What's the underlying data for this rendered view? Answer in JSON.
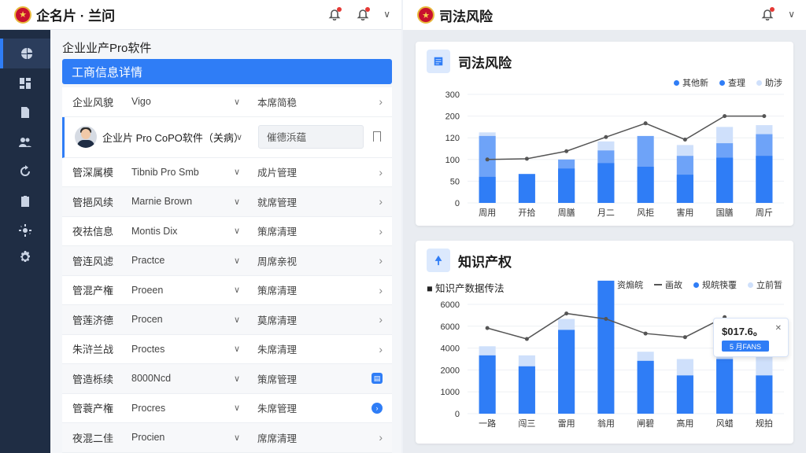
{
  "left": {
    "app_title": "企名片 · 兰问",
    "subtitle": "企业业产Pro软件",
    "section_header": "工商信息详情",
    "rows": [
      {
        "label": "企业风貌",
        "value": "Vigo",
        "status": "本席简稳",
        "end": "arrow"
      },
      {
        "label": "",
        "value": "企业片 Pro CoPO软件（关病）",
        "status": "催德浜蕴",
        "end": "bookmark",
        "selected": true
      },
      {
        "label": "管深属模",
        "value": "Tibnib Pro Smb",
        "status": "成片管理",
        "end": "arrow"
      },
      {
        "label": "管挹风续",
        "value": "Marnie Brown",
        "status": "就席管理",
        "end": "arrow"
      },
      {
        "label": "夜祛信息",
        "value": "Montis Dix",
        "status": "策席清理",
        "end": "arrow"
      },
      {
        "label": "管连风滤",
        "value": "Practce",
        "status": "周席亲视",
        "end": "arrow"
      },
      {
        "label": "管混产権",
        "value": "Proeen",
        "status": "策席清理",
        "end": "arrow"
      },
      {
        "label": "管莲济德",
        "value": "Procen",
        "status": "莫席清理",
        "end": "arrow"
      },
      {
        "label": "朱浒兰战",
        "value": "Proctes",
        "status": "朱席清理",
        "end": "arrow"
      },
      {
        "label": "管造栎续",
        "value": "8000Ncd",
        "status": "策席管理",
        "end": "square"
      },
      {
        "label": "管蓑产権",
        "value": "Procres",
        "status": "朱席管理",
        "end": "circle"
      },
      {
        "label": "夜混二佳",
        "value": "Procien",
        "status": "席席清理",
        "end": "arrow"
      }
    ]
  },
  "right": {
    "app_title": "司法风险",
    "card1": {
      "title": "司法风险",
      "legend": [
        "其他新",
        "查理",
        "助涉"
      ]
    },
    "card2": {
      "title": "知识产权",
      "legend_title": "知识产数据传法",
      "legend": [
        "资煽皖",
        "画故",
        "规皖筷覆",
        "立前暂"
      ],
      "tooltip_value": "$017.6。",
      "tooltip_button": "5 月FANS"
    }
  },
  "colors": {
    "accent": "#2f7df6",
    "bar_light": "#cfe0fb",
    "line": "#555555",
    "nav": "#1f2d44"
  },
  "chart_data": [
    {
      "type": "bar",
      "title": "司法风险",
      "categories": [
        "周用",
        "开拾",
        "周膳",
        "月二",
        "风拒",
        "害用",
        "国膳",
        "周斤"
      ],
      "yticks": [
        0,
        50,
        100,
        120,
        200,
        300
      ],
      "series": [
        {
          "name": "其他新",
          "values": [
            72,
            80,
            95,
            110,
            100,
            78,
            125,
            130
          ]
        },
        {
          "name": "查理",
          "values": [
            185,
            0,
            120,
            145,
            185,
            130,
            165,
            190
          ]
        },
        {
          "name": "助涉",
          "values": [
            195,
            0,
            0,
            170,
            0,
            160,
            210,
            215
          ]
        }
      ],
      "line": [
        120,
        122,
        143,
        182,
        220,
        175,
        240,
        240
      ]
    },
    {
      "type": "bar",
      "title": "知识产权",
      "categories": [
        "一路",
        "闯三",
        "雷用",
        "翁用",
        "闸碧",
        "高用",
        "风蜡",
        "规拍"
      ],
      "yticks": [
        0,
        1000,
        2000,
        4000,
        6000,
        6000
      ],
      "series": [
        {
          "name": "资煽皖",
          "values": [
            3200,
            2600,
            4600,
            7300,
            2900,
            2100,
            3000,
            2100
          ]
        },
        {
          "name": "规皖筷覆",
          "values": [
            3700,
            3200,
            5200,
            0,
            3400,
            3000,
            3900,
            3300
          ]
        }
      ],
      "line": [
        4700,
        4100,
        5500,
        5200,
        4400,
        4200,
        5300,
        3800
      ]
    }
  ]
}
